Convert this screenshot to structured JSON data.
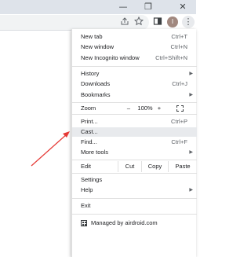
{
  "window": {
    "minimize_glyph": "—",
    "restore_glyph": "❐",
    "close_glyph": "✕"
  },
  "toolbar": {
    "share_icon": "share-icon",
    "bookmark_icon": "star-icon",
    "sidepanel_icon": "side-panel-icon",
    "profile_initial": "I",
    "menu_glyph": "⋮"
  },
  "menu": {
    "new_tab": {
      "label": "New tab",
      "shortcut": "Ctrl+T"
    },
    "new_window": {
      "label": "New window",
      "shortcut": "Ctrl+N"
    },
    "new_incognito": {
      "label": "New Incognito window",
      "shortcut": "Ctrl+Shift+N"
    },
    "history": {
      "label": "History"
    },
    "downloads": {
      "label": "Downloads",
      "shortcut": "Ctrl+J"
    },
    "bookmarks": {
      "label": "Bookmarks"
    },
    "zoom": {
      "label": "Zoom",
      "minus": "–",
      "value": "100%",
      "plus": "+"
    },
    "print": {
      "label": "Print...",
      "shortcut": "Ctrl+P"
    },
    "cast": {
      "label": "Cast..."
    },
    "find": {
      "label": "Find...",
      "shortcut": "Ctrl+F"
    },
    "more_tools": {
      "label": "More tools"
    },
    "edit": {
      "label": "Edit",
      "cut": "Cut",
      "copy": "Copy",
      "paste": "Paste"
    },
    "settings": {
      "label": "Settings"
    },
    "help": {
      "label": "Help"
    },
    "exit": {
      "label": "Exit"
    },
    "managed": {
      "label": "Managed by airdroid.com"
    },
    "submenu_arrow": "▶"
  },
  "colors": {
    "annotation_arrow": "#e53935",
    "hover_highlight": "#e8eaed"
  }
}
